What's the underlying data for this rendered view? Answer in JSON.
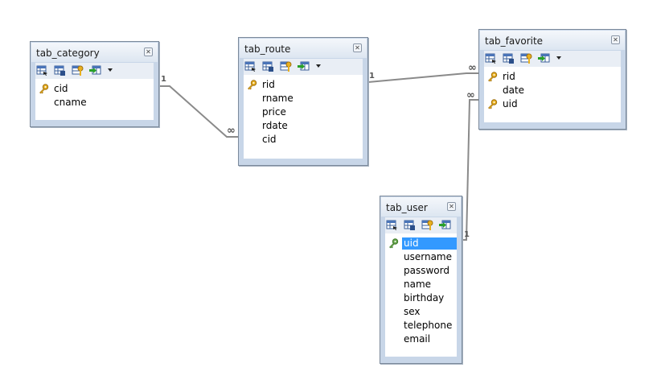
{
  "tables": [
    {
      "id": "tab_category",
      "title": "tab_category",
      "arrow": true,
      "fields": [
        {
          "name": "cid",
          "key": true,
          "selected": false
        },
        {
          "name": "cname",
          "key": false,
          "selected": false
        }
      ]
    },
    {
      "id": "tab_route",
      "title": "tab_route",
      "arrow": true,
      "fields": [
        {
          "name": "rid",
          "key": true,
          "selected": false
        },
        {
          "name": "rname",
          "key": false,
          "selected": false
        },
        {
          "name": "price",
          "key": false,
          "selected": false
        },
        {
          "name": "rdate",
          "key": false,
          "selected": false
        },
        {
          "name": "cid",
          "key": false,
          "selected": false
        }
      ]
    },
    {
      "id": "tab_favorite",
      "title": "tab_favorite",
      "arrow": true,
      "fields": [
        {
          "name": "rid",
          "key": true,
          "selected": false
        },
        {
          "name": "date",
          "key": false,
          "selected": false
        },
        {
          "name": "uid",
          "key": true,
          "selected": false
        }
      ]
    },
    {
      "id": "tab_user",
      "title": "tab_user",
      "arrow": false,
      "fields": [
        {
          "name": "uid",
          "key": true,
          "selected": true
        },
        {
          "name": "username",
          "key": false,
          "selected": false
        },
        {
          "name": "password",
          "key": false,
          "selected": false
        },
        {
          "name": "name",
          "key": false,
          "selected": false
        },
        {
          "name": "birthday",
          "key": false,
          "selected": false
        },
        {
          "name": "sex",
          "key": false,
          "selected": false
        },
        {
          "name": "telephone",
          "key": false,
          "selected": false
        },
        {
          "name": "email",
          "key": false,
          "selected": false
        }
      ]
    }
  ],
  "relations": [
    {
      "from": "tab_category",
      "to": "tab_route",
      "from_card": "1",
      "to_card": "∞"
    },
    {
      "from": "tab_route",
      "to": "tab_favorite",
      "from_card": "1",
      "to_card": "∞"
    },
    {
      "from": "tab_user",
      "to": "tab_favorite",
      "from_card": "1",
      "to_card": "∞"
    }
  ],
  "colors": {
    "frame": "#c8d6e8",
    "selection": "#3399ff",
    "key_gold": "#e8b020",
    "key_green": "#6aa84f",
    "line": "#8a8a8a"
  }
}
